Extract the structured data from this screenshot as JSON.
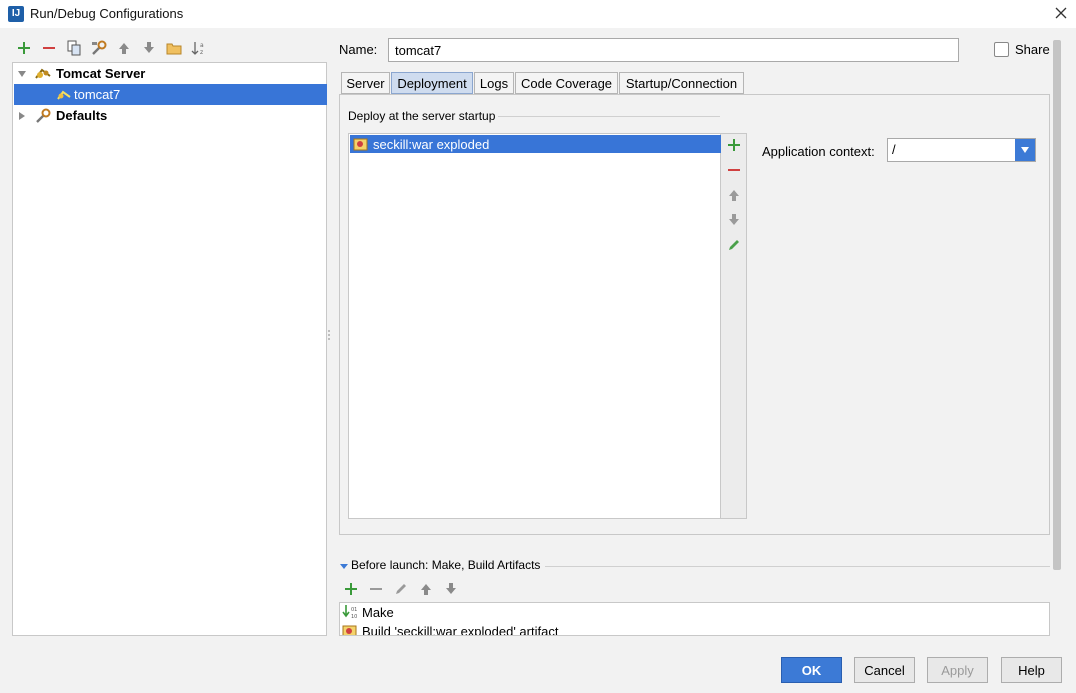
{
  "window": {
    "title": "Run/Debug Configurations",
    "icon_text": "IJ"
  },
  "left_toolbar": {
    "icons": [
      "add-icon",
      "remove-icon",
      "copy-icon",
      "edit-defaults-icon",
      "move-up-icon",
      "move-down-icon",
      "folder-icon",
      "sort-icon"
    ]
  },
  "tree": {
    "items": [
      {
        "label": "Tomcat Server",
        "level": 0,
        "expanded": true
      },
      {
        "label": "tomcat7",
        "level": 1,
        "selected": true
      },
      {
        "label": "Defaults",
        "level": 0,
        "expanded": false
      }
    ]
  },
  "config": {
    "name_label": "Name:",
    "name_value": "tomcat7",
    "share_label": "Share",
    "share_checked": false
  },
  "tabs": [
    {
      "label": "Server"
    },
    {
      "label": "Deployment",
      "active": true
    },
    {
      "label": "Logs"
    },
    {
      "label": "Code Coverage"
    },
    {
      "label": "Startup/Connection"
    }
  ],
  "deployment": {
    "section_label": "Deploy at the server startup",
    "artifacts": [
      "seckill:war exploded"
    ],
    "app_context_label": "Application context:",
    "app_context_value": "/"
  },
  "before_launch": {
    "label": "Before launch: Make, Build Artifacts",
    "tasks": [
      "Make",
      "Build 'seckill:war exploded' artifact"
    ]
  },
  "buttons": {
    "ok": "OK",
    "cancel": "Cancel",
    "apply": "Apply",
    "help": "Help"
  },
  "colors": {
    "accent": "#3c7ad6",
    "selection": "#3875d7",
    "add_green": "#3a9a3a",
    "remove_red": "#d04040"
  }
}
